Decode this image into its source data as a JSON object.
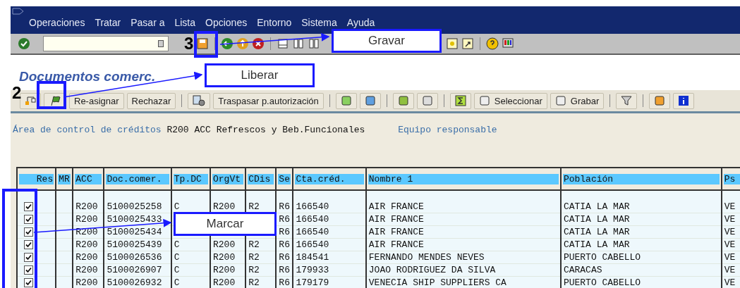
{
  "menu": [
    "Operaciones",
    "Tratar",
    "Pasar a",
    "Lista",
    "Opciones",
    "Entorno",
    "Sistema",
    "Ayuda"
  ],
  "title": "Documentos comerc.",
  "app_toolbar": {
    "buttons": [
      "Re-asignar",
      "Rechazar",
      "Traspasar p.autorización",
      "Seleccionar",
      "Grabar"
    ]
  },
  "info": {
    "label": "Área de control de créditos",
    "value": "R200 ACC Refrescos y Beb.Funcionales",
    "label_2": "Equipo responsable"
  },
  "table": {
    "columns": [
      "Res",
      "MR",
      "ACC",
      "Doc.comer.",
      "Tp.DC",
      "OrgVt",
      "CDis",
      "Se",
      "Cta.créd.",
      "Nombre 1",
      "Población",
      "Ps"
    ],
    "rows": [
      {
        "checked": true,
        "acc": "R200",
        "doc": "5100025258",
        "tp": "C",
        "org": "R200",
        "cdis": "R2",
        "se": "R6",
        "cta": "166540",
        "nombre": "AIR FRANCE",
        "poblacion": "CATIA LA MAR",
        "ps": "VE"
      },
      {
        "checked": true,
        "acc": "R200",
        "doc": "5100025433",
        "se": "R6",
        "cta": "166540",
        "nombre": "AIR FRANCE",
        "poblacion": "CATIA LA MAR",
        "ps": "VE"
      },
      {
        "checked": true,
        "acc": "R200",
        "doc": "5100025434",
        "se": "R6",
        "cta": "166540",
        "nombre": "AIR FRANCE",
        "poblacion": "CATIA LA MAR",
        "ps": "VE"
      },
      {
        "checked": true,
        "acc": "R200",
        "doc": "5100025439",
        "tp": "C",
        "org": "R200",
        "cdis": "R2",
        "se": "R6",
        "cta": "166540",
        "nombre": "AIR FRANCE",
        "poblacion": "CATIA LA MAR",
        "ps": "VE"
      },
      {
        "checked": true,
        "acc": "R200",
        "doc": "5100026536",
        "tp": "C",
        "org": "R200",
        "cdis": "R2",
        "se": "R6",
        "cta": "184541",
        "nombre": "FERNANDO MENDES NEVES",
        "poblacion": "PUERTO CABELLO",
        "ps": "VE"
      },
      {
        "checked": true,
        "acc": "R200",
        "doc": "5100026907",
        "tp": "C",
        "org": "R200",
        "cdis": "R2",
        "se": "R6",
        "cta": "179933",
        "nombre": "JOAO RODRIGUEZ DA SILVA",
        "poblacion": "CARACAS",
        "ps": "VE"
      },
      {
        "checked": true,
        "acc": "R200",
        "doc": "5100026932",
        "tp": "C",
        "org": "R200",
        "cdis": "R2",
        "se": "R6",
        "cta": "179179",
        "nombre": "VENECIA SHIP SUPPLIERS CA",
        "poblacion": "PUERTO CABELLO",
        "ps": "VE"
      }
    ]
  },
  "annotations": {
    "step_save": "3",
    "step_release": "2",
    "callouts": [
      "Gravar",
      "Liberar",
      "Marcar"
    ]
  }
}
